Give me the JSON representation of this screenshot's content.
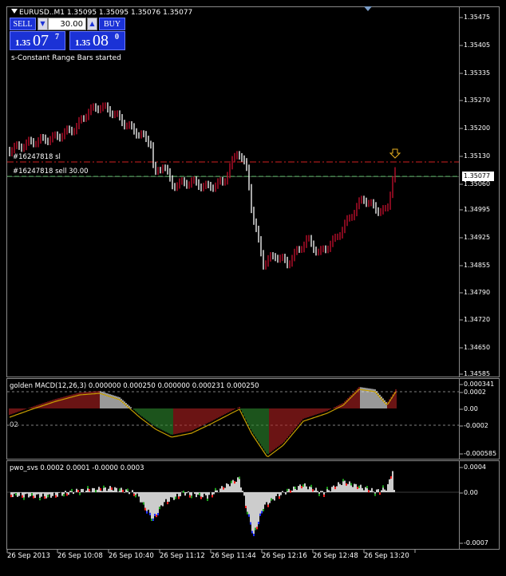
{
  "symbol_header": "EURUSD..M1  1.35095 1.35095 1.35076 1.35077",
  "trade_panel": {
    "sell_label": "SELL",
    "buy_label": "BUY",
    "lot_value": "30.00",
    "sell_base": "1.35",
    "sell_big": "07",
    "sell_sup": "7",
    "buy_base": "1.35",
    "buy_big": "08",
    "buy_sup": "0"
  },
  "status_message": "s-Constant Range Bars started",
  "orders": {
    "sl_label": "#16247818 sl",
    "sell_label": "#16247818 sell 30.00"
  },
  "price_axis": {
    "current_price": "1.35077",
    "labels": [
      "1.35475",
      "1.35405",
      "1.35335",
      "1.35270",
      "1.35200",
      "1.35130",
      "1.35060",
      "1.34995",
      "1.34925",
      "1.34855",
      "1.34790",
      "1.34720",
      "1.34650",
      "1.34585"
    ]
  },
  "macd": {
    "title": "golden MACD(12,26,3) 0.000000 0.000250 0.000000 0.000231 0.000250",
    "levels": [
      "0.000341",
      "0.0002",
      "0.00",
      "-0.0002",
      "-0.000585"
    ],
    "left_mark_top": "02",
    "left_mark_bottom": "02"
  },
  "pwo": {
    "title": "pwo_svs 0.0002 0.0001 -0.0000 0.0003",
    "levels": [
      "0.0004",
      "0.00",
      "-0.0007"
    ]
  },
  "time_axis": [
    "26 Sep 2013",
    "26 Sep 10:08",
    "26 Sep 10:40",
    "26 Sep 11:12",
    "26 Sep 11:44",
    "26 Sep 12:16",
    "26 Sep 12:48",
    "26 Sep 13:20"
  ],
  "colors": {
    "bull": "#c8102e",
    "bear": "#ffffff",
    "sl_line": "#d02020",
    "entry_line": "#3aa04a",
    "macd_green": "#2e8b2e",
    "macd_red": "#b22222",
    "signal": "#c8a000",
    "pwo_white": "#ffffff",
    "pwo_red": "#ff2020",
    "pwo_green": "#1ea01e",
    "pwo_blue": "#2030ff"
  }
}
